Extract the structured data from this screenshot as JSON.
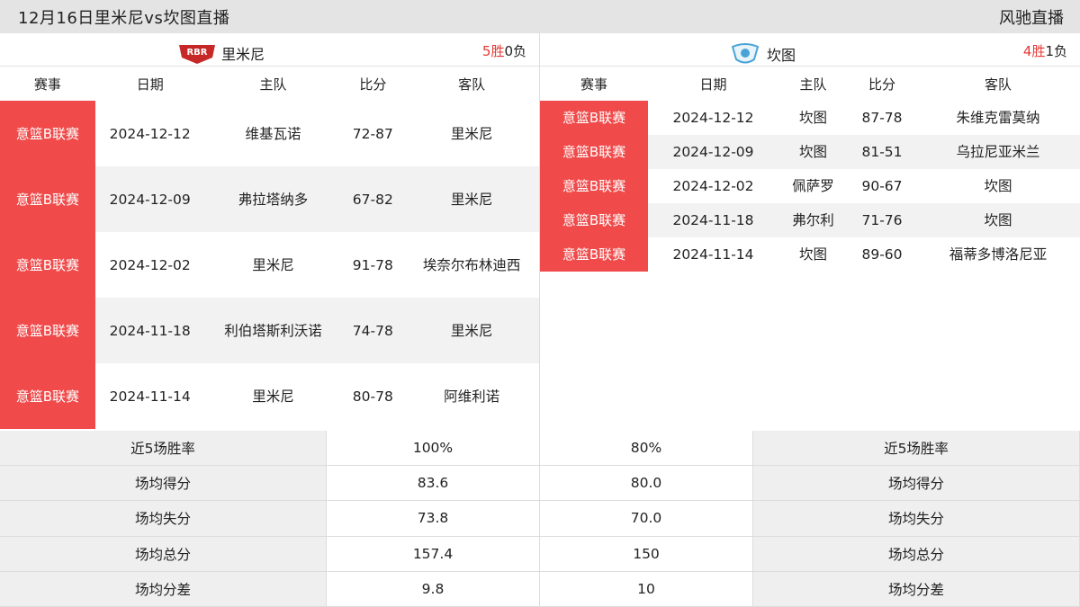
{
  "header": {
    "title": "12月16日里米尼vs坎图直播",
    "brand": "风驰直播"
  },
  "left": {
    "team_name": "里米尼",
    "logo_text": "RBR",
    "record_wins": "5胜",
    "record_losses": "0负",
    "columns": [
      "赛事",
      "日期",
      "主队",
      "比分",
      "客队"
    ],
    "matches": [
      {
        "league": "意篮B联赛",
        "date": "2024-12-12",
        "home": "维基瓦诺",
        "score": "72-87",
        "away": "里米尼"
      },
      {
        "league": "意篮B联赛",
        "date": "2024-12-09",
        "home": "弗拉塔纳多",
        "score": "67-82",
        "away": "里米尼"
      },
      {
        "league": "意篮B联赛",
        "date": "2024-12-02",
        "home": "里米尼",
        "score": "91-78",
        "away": "埃奈尔布林迪西"
      },
      {
        "league": "意篮B联赛",
        "date": "2024-11-18",
        "home": "利伯塔斯利沃诺",
        "score": "74-78",
        "away": "里米尼"
      },
      {
        "league": "意篮B联赛",
        "date": "2024-11-14",
        "home": "里米尼",
        "score": "80-78",
        "away": "阿维利诺"
      }
    ]
  },
  "right": {
    "team_name": "坎图",
    "record_wins": "4胜",
    "record_losses": "1负",
    "columns": [
      "赛事",
      "日期",
      "主队",
      "比分",
      "客队"
    ],
    "matches": [
      {
        "league": "意篮B联赛",
        "date": "2024-12-12",
        "home": "坎图",
        "score": "87-78",
        "away": "朱维克雷莫纳"
      },
      {
        "league": "意篮B联赛",
        "date": "2024-12-09",
        "home": "坎图",
        "score": "81-51",
        "away": "乌拉尼亚米兰"
      },
      {
        "league": "意篮B联赛",
        "date": "2024-12-02",
        "home": "佩萨罗",
        "score": "90-67",
        "away": "坎图"
      },
      {
        "league": "意篮B联赛",
        "date": "2024-11-18",
        "home": "弗尔利",
        "score": "71-76",
        "away": "坎图"
      },
      {
        "league": "意篮B联赛",
        "date": "2024-11-14",
        "home": "坎图",
        "score": "89-60",
        "away": "福蒂多博洛尼亚"
      }
    ]
  },
  "stats": [
    {
      "label": "近5场胜率",
      "left": "100%",
      "right": "80%"
    },
    {
      "label": "场均得分",
      "left": "83.6",
      "right": "80.0"
    },
    {
      "label": "场均失分",
      "left": "73.8",
      "right": "70.0"
    },
    {
      "label": "场均总分",
      "left": "157.4",
      "right": "150"
    },
    {
      "label": "场均分差",
      "left": "9.8",
      "right": "10"
    }
  ],
  "colors": {
    "league_red": "#f04a4a",
    "record_red": "#e53935",
    "header_gray": "#e4e4e4"
  }
}
